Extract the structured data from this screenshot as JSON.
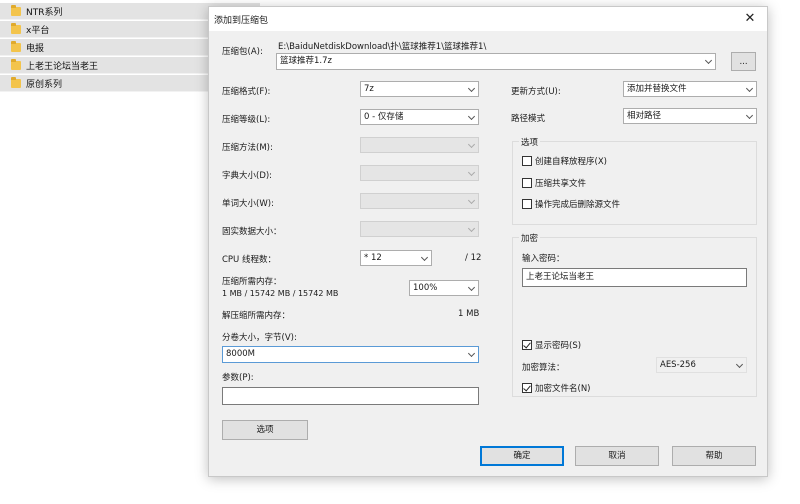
{
  "file_list": [
    {
      "name": "NTR系列"
    },
    {
      "name": "x平台"
    },
    {
      "name": "电报"
    },
    {
      "name": "上老王论坛当老王"
    },
    {
      "name": "原创系列"
    }
  ],
  "dialog": {
    "title": "添加到压缩包",
    "archive_label": "压缩包(A):",
    "archive_path": "E:\\BaiduNetdiskDownload\\扑\\篮球推荐1\\篮球推荐1\\",
    "archive_name": "篮球推荐1.7z",
    "browse_label": "...",
    "format_label": "压缩格式(F):",
    "format_value": "7z",
    "level_label": "压缩等级(L):",
    "level_value": "0 - 仅存储",
    "method_label": "压缩方法(M):",
    "dict_label": "字典大小(D):",
    "word_label": "单词大小(W):",
    "solid_label": "固实数据大小：",
    "cpu_label": "CPU 线程数：",
    "cpu_value": "* 12",
    "cpu_max": "/ 12",
    "mem_label": "压缩所需内存：",
    "mem_detail": "1 MB / 15742 MB / 15742 MB",
    "mem_percent": "100%",
    "decomp_label": "解压缩所需内存：",
    "decomp_value": "1 MB",
    "volume_label": "分卷大小，字节(V):",
    "volume_value": "8000M",
    "params_label": "参数(P):",
    "params_value": "",
    "options_button": "选项",
    "update_label": "更新方式(U):",
    "update_value": "添加并替换文件",
    "path_label": "路径模式",
    "path_value": "相对路径",
    "options_group": "选项",
    "opt_sfx": "创建自释放程序(X)",
    "opt_shared": "压缩共享文件",
    "opt_delete": "操作完成后删除源文件",
    "encrypt_group": "加密",
    "password_label": "输入密码：",
    "password_value": "上老王论坛当老王",
    "show_password": "显示密码(S)",
    "encrypt_method_label": "加密算法：",
    "encrypt_method_value": "AES-256",
    "encrypt_names": "加密文件名(N)",
    "ok_button": "确定",
    "cancel_button": "取消",
    "help_button": "帮助"
  }
}
